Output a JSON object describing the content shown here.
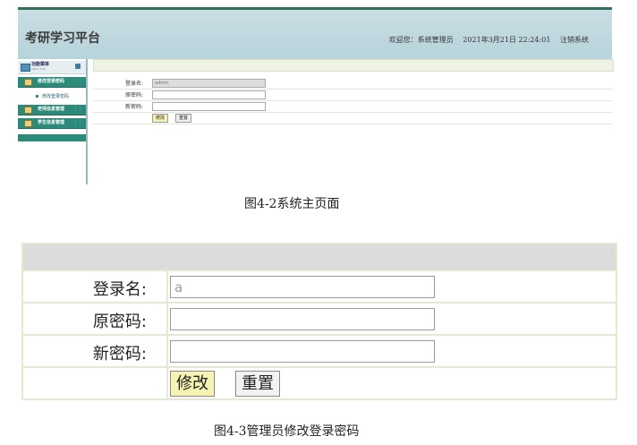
{
  "figure1": {
    "app_title": "考研学习平台",
    "header": {
      "welcome_label": "欢迎您：系统管理员",
      "datetime": "2021年3月21日 22:24:01",
      "logout_label": "注销系统"
    },
    "sidebar": {
      "menu_title": "功能菜单",
      "menu_subtitle": "MENU BAR",
      "items": [
        {
          "label": "修改登录密码"
        },
        {
          "label": "老师信息管理"
        },
        {
          "label": "学生信息管理"
        }
      ],
      "sub_item": "修改登录密码"
    },
    "form": {
      "username_label": "登录名:",
      "username_value": "admin",
      "old_password_label": "原密码:",
      "new_password_label": "新密码:",
      "submit_label": "修改",
      "reset_label": "重置"
    },
    "caption": "图4-2系统主页面"
  },
  "figure2": {
    "form": {
      "username_label": "登录名:",
      "username_value": "a",
      "old_password_label": "原密码:",
      "new_password_label": "新密码:",
      "submit_label": "修改",
      "reset_label": "重置"
    },
    "caption": "图4-3管理员修改登录密码"
  }
}
